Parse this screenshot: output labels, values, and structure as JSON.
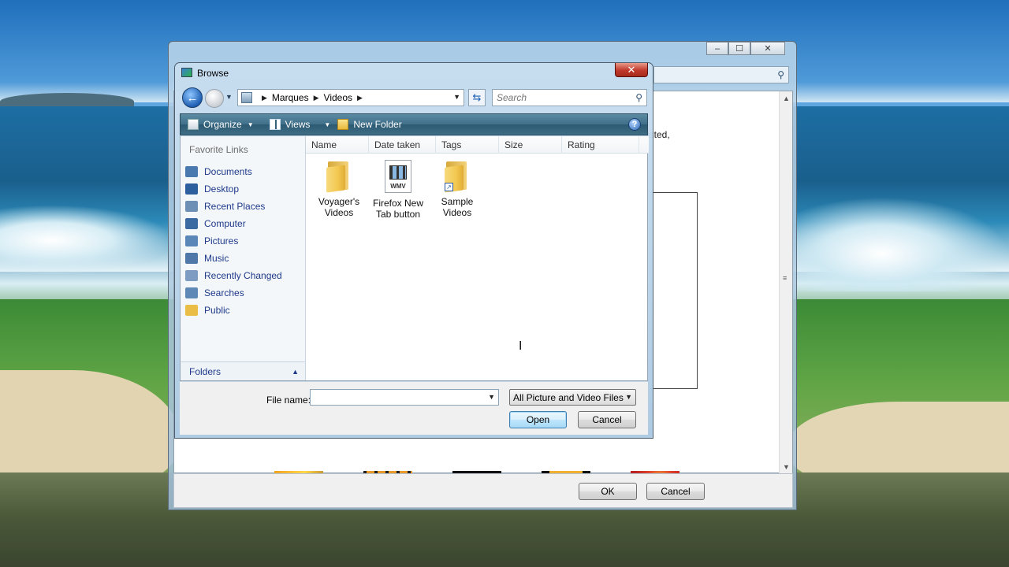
{
  "dialog": {
    "title": "Browse",
    "close_label": "✕",
    "address": {
      "crumbs": [
        "Marques",
        "Videos"
      ]
    },
    "search": {
      "placeholder": "Search"
    },
    "toolbar": {
      "organize": "Organize",
      "views": "Views",
      "new_folder": "New Folder",
      "help": "?"
    },
    "nav": {
      "heading": "Favorite Links",
      "items": [
        {
          "label": "Documents",
          "icon": "documents-icon",
          "color": "#4a79b0"
        },
        {
          "label": "Desktop",
          "icon": "desktop-icon",
          "color": "#2d5f9e"
        },
        {
          "label": "Recent Places",
          "icon": "recent-places-icon",
          "color": "#6e8fb5"
        },
        {
          "label": "Computer",
          "icon": "computer-icon",
          "color": "#3b6aa3"
        },
        {
          "label": "Pictures",
          "icon": "pictures-icon",
          "color": "#5a86b8"
        },
        {
          "label": "Music",
          "icon": "music-icon",
          "color": "#4f77a8"
        },
        {
          "label": "Recently Changed",
          "icon": "recently-changed-icon",
          "color": "#7e9cc2"
        },
        {
          "label": "Searches",
          "icon": "searches-icon",
          "color": "#5f88b6"
        },
        {
          "label": "Public",
          "icon": "public-folder-icon",
          "color": "#e9bd46"
        }
      ],
      "folders_label": "Folders"
    },
    "columns": [
      "Name",
      "Date taken",
      "Tags",
      "Size",
      "Rating"
    ],
    "files": [
      {
        "line1": "Voyager's",
        "line2": "Videos",
        "type": "folder"
      },
      {
        "line1": "Firefox New",
        "line2": "Tab button",
        "type": "wmv",
        "badge": "WMV"
      },
      {
        "line1": "Sample",
        "line2": "Videos",
        "type": "folder-shortcut"
      }
    ],
    "file_name": {
      "label": "File name:",
      "value": ""
    },
    "file_type": "All Picture and Video Files",
    "open_label": "Open",
    "cancel_label": "Cancel"
  },
  "background_window": {
    "fragment_text": "isted,",
    "ok_label": "OK",
    "cancel_label": "Cancel",
    "controls": [
      "–",
      "☐",
      "✕"
    ]
  }
}
